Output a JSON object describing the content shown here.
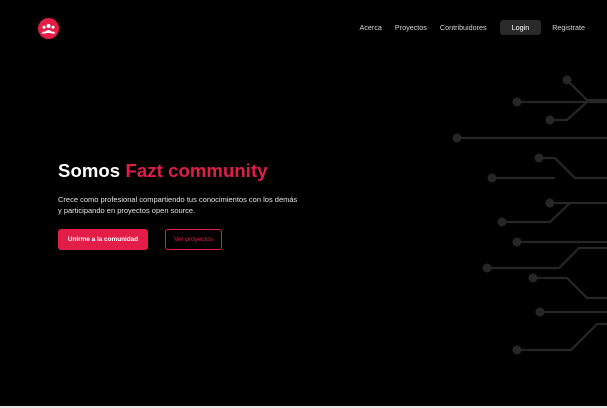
{
  "brand": {
    "logo_icon": "community-logo-icon",
    "accent_color": "#e11d48"
  },
  "nav": {
    "items": [
      {
        "label": "Acerca"
      },
      {
        "label": "Proyectos"
      },
      {
        "label": "Contribuidores"
      }
    ],
    "login_label": "Login",
    "register_label": "Registrate"
  },
  "hero": {
    "title_prefix": "Somos",
    "title_accent": "Fazt community",
    "description": "Crece como profesional compartiendo tus conocimientos con los demás y participando en proyectos open source.",
    "primary_cta": "Unirme a la comunidad",
    "secondary_cta": "Ver proyectos"
  },
  "decor": {
    "icon": "circuit-lines-icon",
    "line_color": "#262626"
  }
}
